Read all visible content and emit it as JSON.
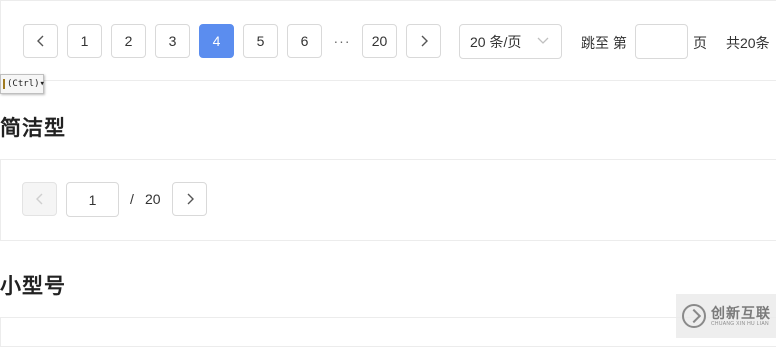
{
  "full_pager": {
    "pages": [
      "1",
      "2",
      "3",
      "4",
      "5",
      "6"
    ],
    "active_page": "4",
    "ellipsis": "···",
    "last_page": "20",
    "page_size": "20 条/页",
    "jump_prefix": "跳至 第",
    "jump_suffix": "页",
    "total": "共20条",
    "accent_color": "#5b8def"
  },
  "paste_hint": {
    "label": "(Ctrl)▾"
  },
  "simple_section": {
    "title": "简洁型",
    "current_page": "1",
    "separator": "/",
    "total_pages": "20"
  },
  "small_section": {
    "title": "小型号"
  },
  "watermark": {
    "main": "创新互联",
    "sub": "CHUANG XIN HU LIAN"
  }
}
